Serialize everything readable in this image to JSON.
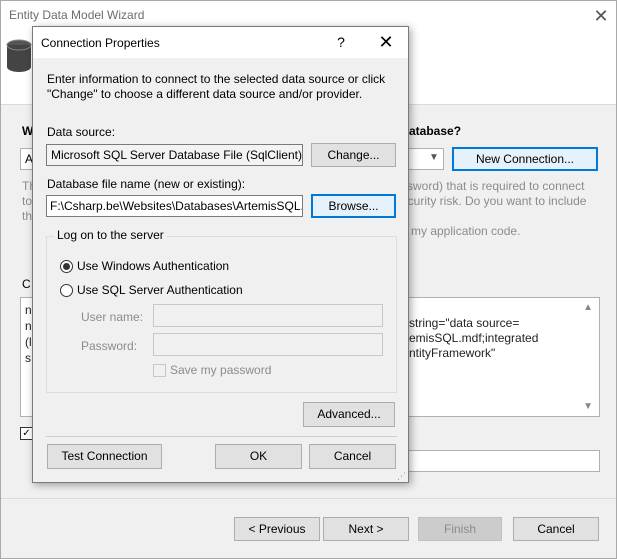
{
  "wizard": {
    "title": "Entity Data Model Wizard",
    "close_glyph": "✕",
    "question_fragment": "atabase?",
    "left_heading_fragment": "W",
    "combo_fragment": "A",
    "new_connection_label": "New Connection...",
    "description_fragment": "ssword) that is required to connect\necurity risk. Do you want to include\n\nn my application code.",
    "description_left_fragment": "Th\nto\nth",
    "conn_label_fragment": "C",
    "conn_string_fragment": "string=\"data source=\nemisSQL.mdf;integrated\nntityFramework\"",
    "conn_left_fragment": "n\nn\n(l\ns",
    "buttons": {
      "previous": "< Previous",
      "next": "Next >",
      "finish": "Finish",
      "cancel": "Cancel"
    }
  },
  "dialog": {
    "title": "Connection Properties",
    "help_glyph": "?",
    "close_glyph": "✕",
    "intro": "Enter information to connect to the selected data source or click \"Change\" to choose a different data source and/or provider.",
    "data_source_label": "Data source:",
    "data_source_value": "Microsoft SQL Server Database File (SqlClient)",
    "change_button": "Change...",
    "db_file_label": "Database file name (new or existing):",
    "db_file_value": "F:\\Csharp.be\\Websites\\Databases\\ArtemisSQL.mdf",
    "browse_button": "Browse...",
    "logon_group_label": "Log on to the server",
    "auth_windows_label": "Use Windows Authentication",
    "auth_sql_label": "Use SQL Server Authentication",
    "auth_selected": "windows",
    "username_label": "User name:",
    "username_value": "",
    "password_label": "Password:",
    "password_value": "",
    "save_password_label": "Save my password",
    "save_password_checked": false,
    "advanced_button": "Advanced...",
    "test_connection_button": "Test Connection",
    "ok_button": "OK",
    "cancel_button": "Cancel"
  },
  "colors": {
    "focus_border": "#0078d7",
    "focus_fill": "#e5f1fb",
    "disabled_text": "#8b8b8b"
  }
}
